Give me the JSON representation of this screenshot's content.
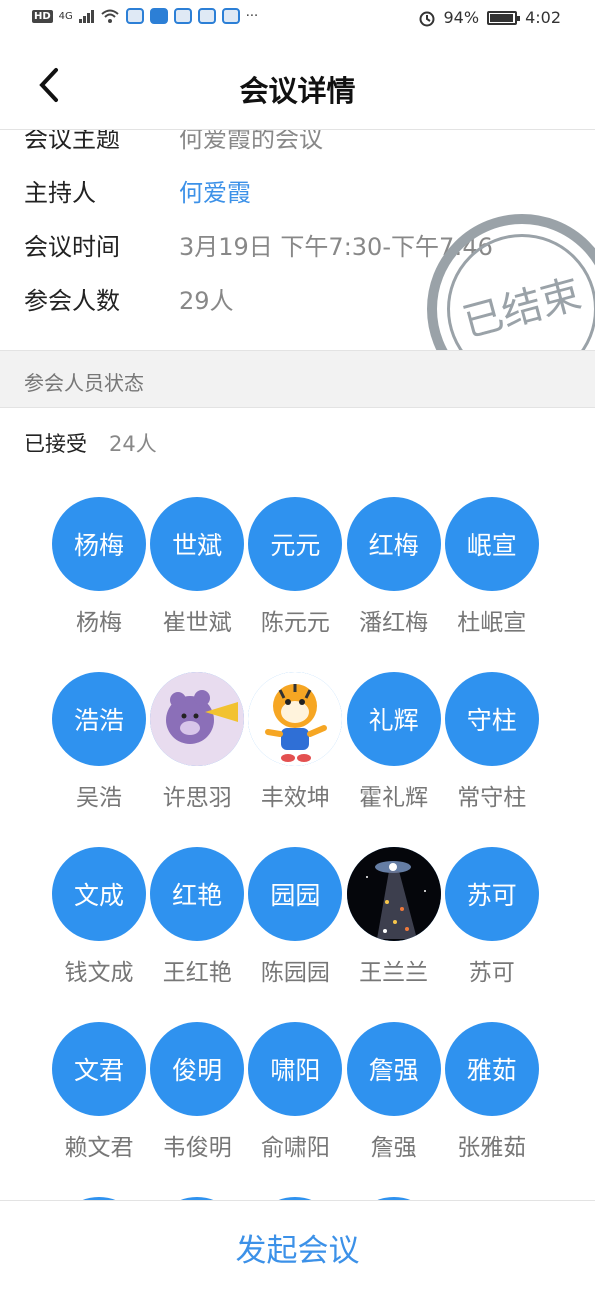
{
  "status_bar": {
    "hd": "HD",
    "network": "4G",
    "dots": "···",
    "battery_percent": "94%",
    "battery_level": 0.94,
    "time": "4:02"
  },
  "header": {
    "title": "会议详情",
    "back_icon": "chevron-left-icon"
  },
  "info": {
    "topic_label": "会议主题",
    "topic_value": "何爱霞的会议",
    "host_label": "主持人",
    "host_value": "何爱霞",
    "time_label": "会议时间",
    "time_value": "3月19日 下午7:30-下午7:46",
    "count_label": "参会人数",
    "count_value": "29人"
  },
  "stamp": {
    "text": "已结束"
  },
  "section": {
    "title": "参会人员状态"
  },
  "accepted": {
    "label": "已接受",
    "count": "24人"
  },
  "participants": [
    {
      "avatar": "杨梅",
      "name": "杨梅"
    },
    {
      "avatar": "世斌",
      "name": "崔世斌"
    },
    {
      "avatar": "元元",
      "name": "陈元元"
    },
    {
      "avatar": "红梅",
      "name": "潘红梅"
    },
    {
      "avatar": "岷宣",
      "name": "杜岷宣"
    },
    {
      "avatar": "浩浩",
      "name": "吴浩"
    },
    {
      "avatar": "",
      "name": "许思羽",
      "image": "bear"
    },
    {
      "avatar": "",
      "name": "丰效坤",
      "image": "tiger"
    },
    {
      "avatar": "礼辉",
      "name": "霍礼辉"
    },
    {
      "avatar": "守柱",
      "name": "常守柱"
    },
    {
      "avatar": "文成",
      "name": "钱文成"
    },
    {
      "avatar": "红艳",
      "name": "王红艳"
    },
    {
      "avatar": "园园",
      "name": "陈园园"
    },
    {
      "avatar": "",
      "name": "王兰兰",
      "image": "galaxy"
    },
    {
      "avatar": "苏可",
      "name": "苏可"
    },
    {
      "avatar": "文君",
      "name": "赖文君"
    },
    {
      "avatar": "俊明",
      "name": "韦俊明"
    },
    {
      "avatar": "啸阳",
      "name": "俞啸阳"
    },
    {
      "avatar": "詹强",
      "name": "詹强"
    },
    {
      "avatar": "雅茹",
      "name": "张雅茹"
    }
  ],
  "bottom": {
    "button_label": "发起会议"
  },
  "colors": {
    "accent": "#3c91e8",
    "avatar_bg": "#2f92ef"
  }
}
